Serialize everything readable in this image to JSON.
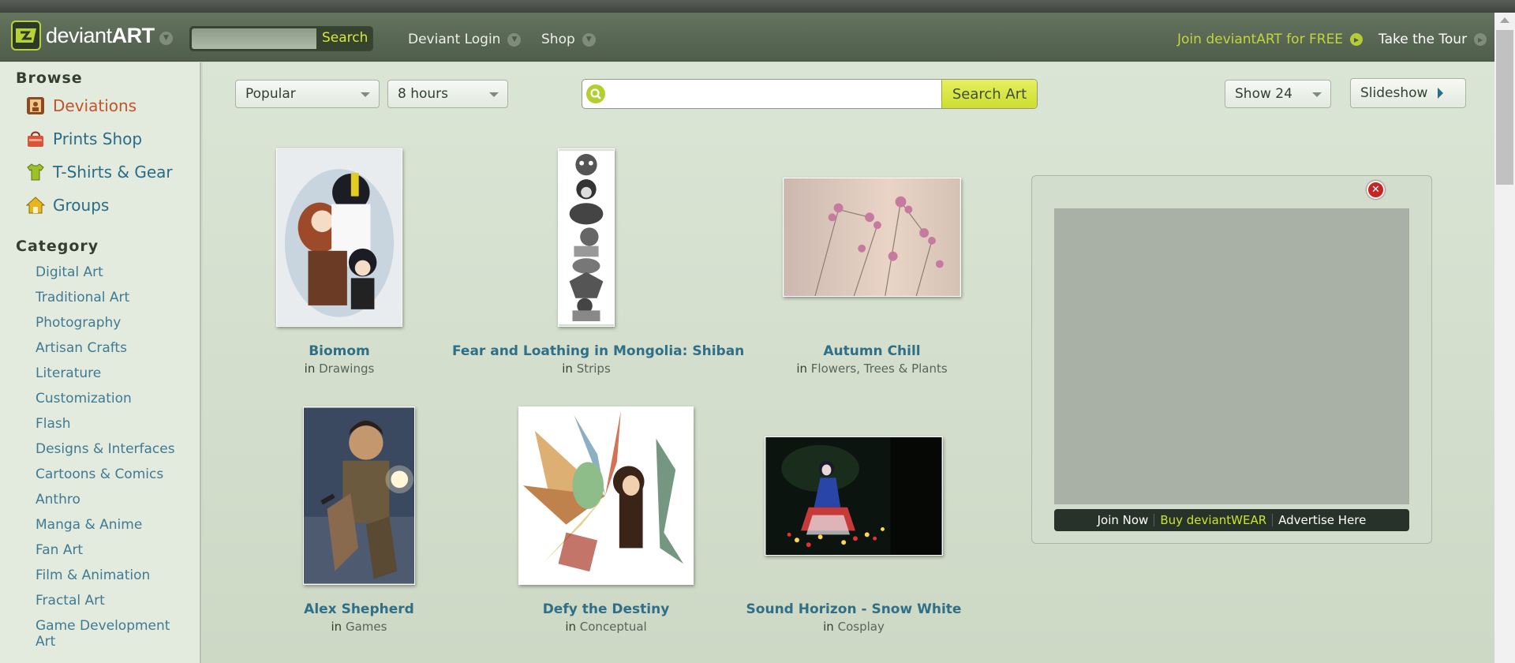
{
  "header": {
    "logo_text": "deviant",
    "logo_bold": "ART",
    "search_button": "Search",
    "nav_login": "Deviant Login",
    "nav_shop": "Shop",
    "join_text": "Join deviantART for FREE",
    "tour_text": "Take the Tour"
  },
  "sidebar": {
    "browse_heading": "Browse",
    "browse_items": [
      {
        "label": "Deviations",
        "icon": "portrait-frame-icon",
        "active": true
      },
      {
        "label": "Prints Shop",
        "icon": "shopping-bag-icon"
      },
      {
        "label": "T-Shirts & Gear",
        "icon": "tshirt-icon"
      },
      {
        "label": "Groups",
        "icon": "house-icon"
      }
    ],
    "category_heading": "Category",
    "categories": [
      "Digital Art",
      "Traditional Art",
      "Photography",
      "Artisan Crafts",
      "Literature",
      "Customization",
      "Flash",
      "Designs & Interfaces",
      "Cartoons & Comics",
      "Anthro",
      "Manga & Anime",
      "Fan Art",
      "Film & Animation",
      "Fractal Art",
      "Game Development Art"
    ]
  },
  "toolbar": {
    "sort_value": "Popular",
    "time_value": "8 hours",
    "search_placeholder": "",
    "search_button": "Search Art",
    "show_value": "Show 24",
    "slideshow_label": "Slideshow"
  },
  "gallery": [
    {
      "title": "Biomom",
      "in": "in",
      "category": "Drawings"
    },
    {
      "title": "Fear and Loathing in Mongolia: Shiban",
      "in": "in",
      "category": "Strips"
    },
    {
      "title": "Autumn Chill",
      "in": "in",
      "category": "Flowers, Trees & Plants"
    },
    {
      "title": "Alex Shepherd",
      "in": "in",
      "category": "Games"
    },
    {
      "title": "Defy the Destiny",
      "in": "in",
      "category": "Conceptual"
    },
    {
      "title": "Sound Horizon - Snow White",
      "in": "in",
      "category": "Cosplay"
    }
  ],
  "ad": {
    "join_now": "Join Now",
    "buy_wear": "Buy deviantWEAR",
    "advertise": "Advertise Here"
  },
  "colors": {
    "accent_green": "#c0d63c",
    "link_blue": "#2f6f87",
    "active_red": "#c0542a"
  }
}
